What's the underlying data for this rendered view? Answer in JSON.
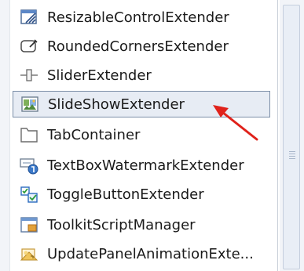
{
  "toolbox": {
    "items": [
      {
        "label": "ResizableControlExtender",
        "icon": "resize-icon",
        "selected": false
      },
      {
        "label": "RoundedCornersExtender",
        "icon": "rounded-corners-icon",
        "selected": false
      },
      {
        "label": "SliderExtender",
        "icon": "slider-icon",
        "selected": false
      },
      {
        "label": "SlideShowExtender",
        "icon": "slideshow-icon",
        "selected": true
      },
      {
        "label": "TabContainer",
        "icon": "tab-container-icon",
        "selected": false
      },
      {
        "label": "TextBoxWatermarkExtender",
        "icon": "textbox-watermark-icon",
        "selected": false
      },
      {
        "label": "ToggleButtonExtender",
        "icon": "toggle-button-icon",
        "selected": false
      },
      {
        "label": "ToolkitScriptManager",
        "icon": "script-manager-icon",
        "selected": false
      },
      {
        "label": "UpdatePanelAnimationExte...",
        "icon": "update-panel-animation-icon",
        "selected": false
      }
    ]
  },
  "colors": {
    "selection_border": "#7c8fa8",
    "selection_fill": "#e7ecf4",
    "annotation_arrow": "#e0221b"
  }
}
